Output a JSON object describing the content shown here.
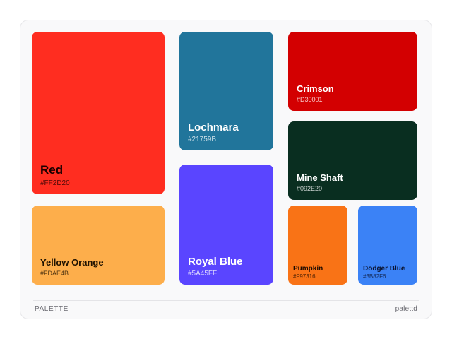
{
  "palette": {
    "label": "PALETTE",
    "brand": "palettd",
    "swatches": [
      {
        "name": "Red",
        "hex": "#FF2D20",
        "text_color": "#1a0000"
      },
      {
        "name": "Yellow Orange",
        "hex": "#FDAE4B",
        "text_color": "#1f1200"
      },
      {
        "name": "Lochmara",
        "hex": "#21759B",
        "text_color": "#ffffff"
      },
      {
        "name": "Royal Blue",
        "hex": "#5A45FF",
        "text_color": "#ffffff"
      },
      {
        "name": "Crimson",
        "hex": "#D30001",
        "text_color": "#ffffff"
      },
      {
        "name": "Mine Shaft",
        "hex": "#092E20",
        "text_color": "#ffffff"
      },
      {
        "name": "Pumpkin",
        "hex": "#F97316",
        "text_color": "#1f0b00"
      },
      {
        "name": "Dodger Blue",
        "hex": "#3B82F6",
        "text_color": "#0a1330"
      }
    ]
  }
}
